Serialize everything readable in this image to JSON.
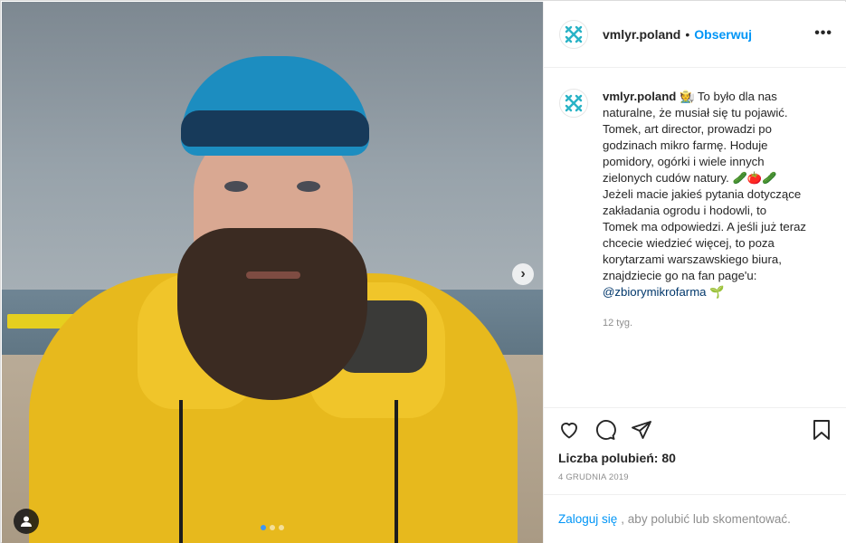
{
  "post": {
    "account": "vmlyr.poland",
    "header_separator": "•",
    "follow_label": "Obserwuj",
    "more_label": "•••",
    "caption": {
      "username": "vmlyr.poland",
      "lines": [
        "To było dla nas",
        "naturalne, że musiał się tu pojawić.",
        "Tomek, art director, prowadzi po",
        "godzinach mikro farmę. Hoduje",
        "pomidory, ogórki i wiele innych",
        "zielonych cudów natury.",
        "Jeżeli macie jakieś pytania dotyczące",
        "zakładania ogrodu i hodowli, to",
        "Tomek ma odpowiedzi. A jeśli już teraz",
        "chcecie wiedzieć więcej, to poza",
        "korytarzami warszawskiego biura,",
        "znajdziecie go na fan page'u:"
      ],
      "emoji_farmer": "🧑‍🌾",
      "emoji_veggies": "🥒🍅🥒",
      "mention": "@zbiorymikrofarma",
      "emoji_sprout": "🌱",
      "time_ago": "12 tyg."
    },
    "likes_text": "Liczba polubień: 80",
    "date_text": "4 GRUDNIA 2019",
    "login": {
      "link_label": "Zaloguj się",
      "rest_text": ", aby polubić lub skomentować."
    },
    "carousel": {
      "current_index": 1,
      "total": 3,
      "next_label": "›"
    }
  },
  "icons": {
    "logo": "vml-logo-icon",
    "like": "heart-icon",
    "comment": "comment-icon",
    "share": "share-icon",
    "save": "bookmark-icon",
    "next": "chevron-right-icon",
    "user_tag": "user-icon"
  },
  "colors": {
    "link_blue": "#0095f6",
    "mention_blue": "#00376b",
    "logo_teal": "#2ab3c6"
  }
}
